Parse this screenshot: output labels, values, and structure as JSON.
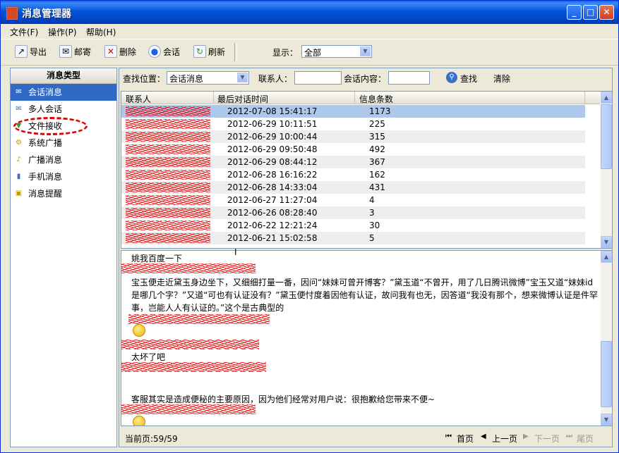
{
  "window": {
    "title": "消息管理器",
    "min": "_",
    "max": "□",
    "close": "✕"
  },
  "menu": [
    "文件(F)",
    "操作(P)",
    "帮助(H)"
  ],
  "toolbar": {
    "export": "导出",
    "mail": "邮寄",
    "delete": "删除",
    "chat": "会话",
    "refresh": "刷新",
    "display_label": "显示：",
    "display_value": "全部"
  },
  "sidebar": {
    "header": "消息类型",
    "items": [
      "会话消息",
      "多人会话",
      "文件接收",
      "系统广播",
      "广播消息",
      "手机消息",
      "消息提醒"
    ]
  },
  "search": {
    "location_label": "查找位置：",
    "location_value": "会话消息",
    "contact_label": "联系人：",
    "content_label": "会话内容：",
    "find": "查找",
    "clear": "清除"
  },
  "table": {
    "headers": [
      "联系人",
      "最后对话时间",
      "信息条数"
    ],
    "rows": [
      {
        "time": "2012-07-08 15:41:17",
        "count": "1173"
      },
      {
        "time": "2012-06-29 10:11:51",
        "count": "225"
      },
      {
        "time": "2012-06-29 10:00:44",
        "count": "315"
      },
      {
        "time": "2012-06-29 09:50:48",
        "count": "492"
      },
      {
        "time": "2012-06-29 08:44:12",
        "count": "367"
      },
      {
        "time": "2012-06-28 16:16:22",
        "count": "162"
      },
      {
        "time": "2012-06-28 14:33:04",
        "count": "431"
      },
      {
        "time": "2012-06-27 11:27:04",
        "count": "4"
      },
      {
        "time": "2012-06-26 08:28:40",
        "count": "3"
      },
      {
        "time": "2012-06-22 12:21:24",
        "count": "30"
      },
      {
        "time": "2012-06-21 15:02:58",
        "count": "5"
      }
    ]
  },
  "messages": {
    "line1": "姚我百度一下",
    "body": "宝玉便走近黛玉身边坐下，又细细打量一番，因问“妹妹可曾开博客？”黛玉道“不曾开，用了几日腾讯微博”宝玉又道“妹妹id是哪几个字？”又道“可也有认证没有？”黛玉便忖度着因他有认证，故问我有也无，因答道“我没有那个，想来微博认证是件罕事，岂能人人有认证的。”这个是古典型的",
    "line_short": "太坏了吧",
    "line_last": "客服其实是造成便秘的主要原因，因为他们经常对用户说：很抱歉给您带来不便~"
  },
  "pager": {
    "current": "当前页:59/59",
    "first": "首页",
    "prev": "上一页",
    "next": "下一页",
    "last": "尾页"
  }
}
